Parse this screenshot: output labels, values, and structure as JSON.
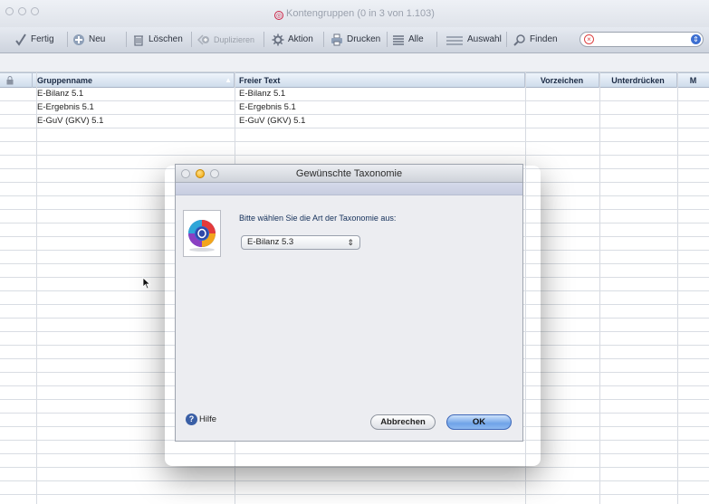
{
  "window": {
    "title": "Kontengruppen (0 in 3 von 1.103)"
  },
  "toolbar": {
    "fertig": "Fertig",
    "neu": "Neu",
    "loeschen": "Löschen",
    "duplizieren": "Duplizieren",
    "aktion": "Aktion",
    "drucken": "Drucken",
    "alle": "Alle",
    "auswahl": "Auswahl",
    "finden": "Finden",
    "search_value": ""
  },
  "table": {
    "columns": [
      "Gruppenname",
      "Freier Text",
      "Vorzeichen",
      "Unterdrücken",
      "M"
    ],
    "rows": [
      {
        "gruppenname": "E-Bilanz 5.1",
        "freier_text": "E-Bilanz 5.1",
        "vorzeichen": "",
        "unterdruecken": "",
        "m": ""
      },
      {
        "gruppenname": "E-Ergebnis 5.1",
        "freier_text": "E-Ergebnis 5.1",
        "vorzeichen": "",
        "unterdruecken": "",
        "m": ""
      },
      {
        "gruppenname": "E-GuV (GKV) 5.1",
        "freier_text": "E-GuV (GKV) 5.1",
        "vorzeichen": "",
        "unterdruecken": "",
        "m": ""
      }
    ]
  },
  "dialog": {
    "title": "Gewünschte Taxonomie",
    "prompt": "Bitte wählen Sie die Art der Taxonomie aus:",
    "select_value": "E-Bilanz 5.3",
    "help_label": "Hilfe",
    "cancel_label": "Abbrechen",
    "ok_label": "OK"
  },
  "colors": {
    "accent": "#6fa3e8",
    "header_bg": "#cfdcec",
    "clear_red": "#dd4444"
  }
}
